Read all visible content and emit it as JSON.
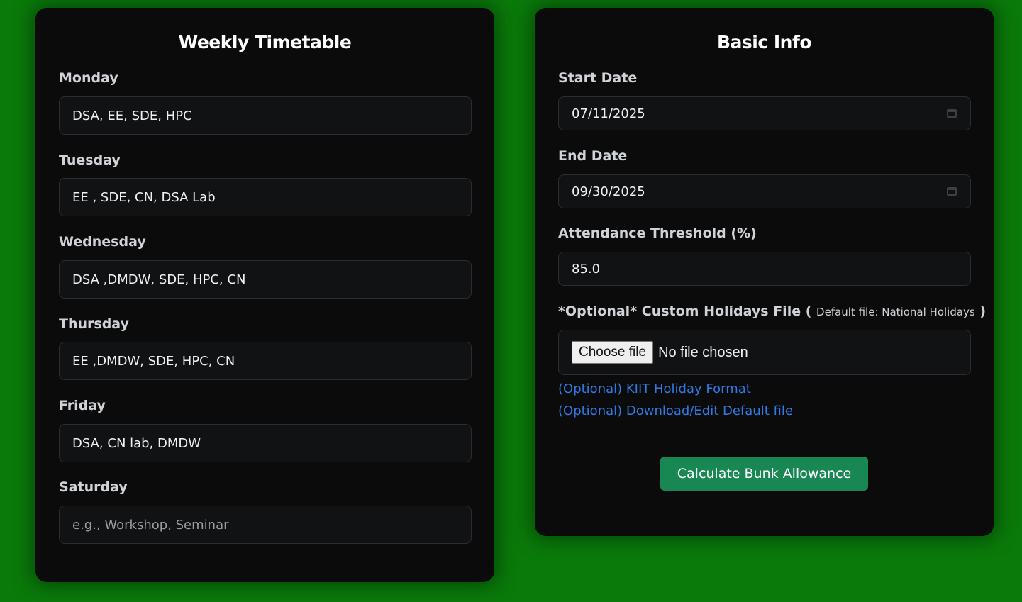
{
  "timetable": {
    "title": "Weekly Timetable",
    "days": [
      {
        "label": "Monday",
        "value": "DSA, EE, SDE, HPC",
        "placeholder": ""
      },
      {
        "label": "Tuesday",
        "value": "EE , SDE, CN, DSA Lab",
        "placeholder": ""
      },
      {
        "label": "Wednesday",
        "value": "DSA ,DMDW, SDE, HPC, CN",
        "placeholder": ""
      },
      {
        "label": "Thursday",
        "value": "EE ,DMDW, SDE, HPC, CN",
        "placeholder": ""
      },
      {
        "label": "Friday",
        "value": "DSA, CN lab, DMDW",
        "placeholder": ""
      },
      {
        "label": "Saturday",
        "value": "",
        "placeholder": "e.g., Workshop, Seminar"
      }
    ]
  },
  "basic_info": {
    "title": "Basic Info",
    "start_date_label": "Start Date",
    "start_date_value": "07/11/2025",
    "end_date_label": "End Date",
    "end_date_value": "09/30/2025",
    "threshold_label": "Attendance Threshold (%)",
    "threshold_value": "85.0",
    "holidays_label": "*Optional* Custom Holidays File (",
    "holidays_note": "Default file: National Holidays",
    "holidays_label_close": ")",
    "choose_file_label": "Choose file",
    "file_status": "No file chosen",
    "link_format": "(Optional) KIIT Holiday Format",
    "link_default": "(Optional) Download/Edit Default file",
    "calculate_label": "Calculate Bunk Allowance"
  },
  "colors": {
    "background": "#0a7a0a",
    "panel": "#0b0b0c",
    "button": "#198754",
    "link": "#2f7be6"
  },
  "icons": [
    "calendar-icon"
  ]
}
